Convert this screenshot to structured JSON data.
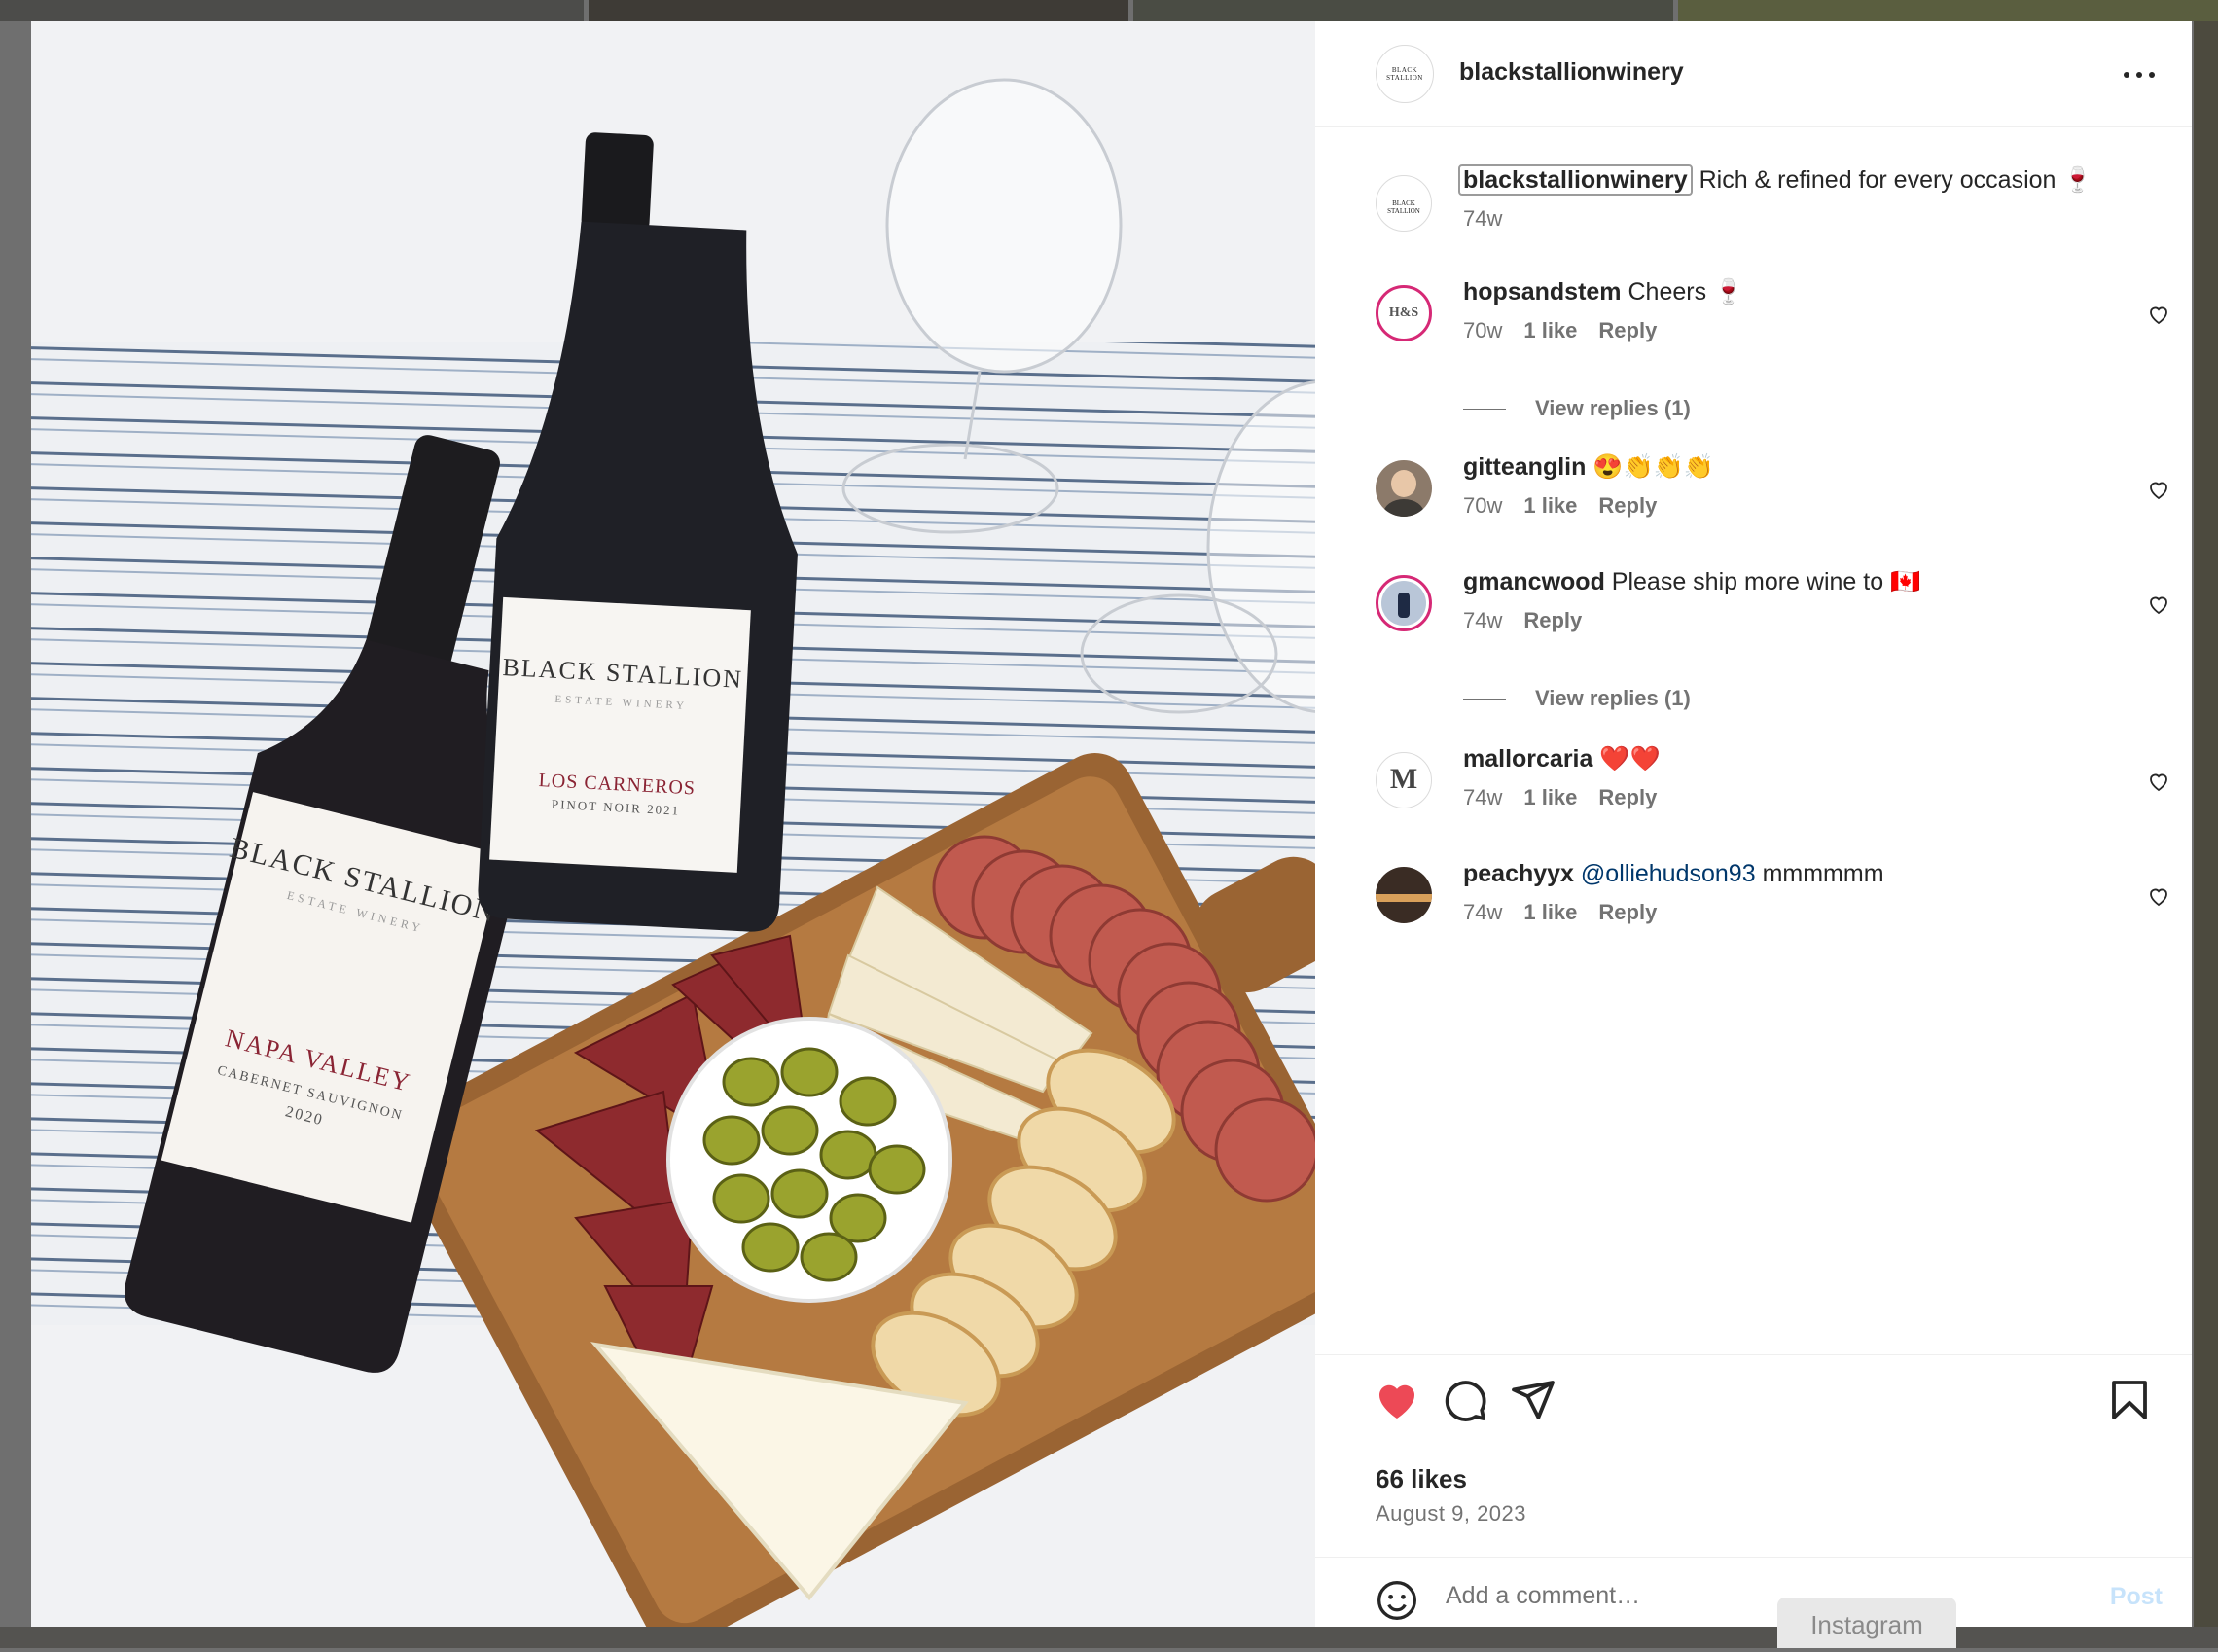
{
  "post": {
    "username": "blackstallionwinery",
    "avatar_logo_text": "BLACK STALLION",
    "caption": {
      "username": "blackstallionwinery",
      "text": "Rich & refined for every occasion 🍷",
      "age": "74w"
    },
    "photo": {
      "bottle_left": {
        "brand": "BLACK STALLION",
        "sub": "ESTATE WINERY",
        "region": "NAPA VALLEY",
        "varietal": "CABERNET SAUVIGNON",
        "year": "2020"
      },
      "bottle_right": {
        "brand": "BLACK STALLION",
        "sub": "ESTATE WINERY",
        "region": "LOS CARNEROS",
        "varietal": "PINOT NOIR 2021"
      }
    }
  },
  "comments": [
    {
      "username": "hopsandstem",
      "text": "Cheers 🍷",
      "age": "70w",
      "likes": "1 like",
      "reply": "Reply",
      "view_replies": "View replies (1)",
      "avatar_text": "H&S"
    },
    {
      "username": "gitteanglin",
      "text": "😍👏👏👏",
      "age": "70w",
      "likes": "1 like",
      "reply": "Reply"
    },
    {
      "username": "gmancwood",
      "text": "Please ship more wine to 🇨🇦",
      "age": "74w",
      "reply": "Reply",
      "view_replies": "View replies (1)"
    },
    {
      "username": "mallorcaria",
      "text": "❤️❤️",
      "age": "74w",
      "likes": "1 like",
      "reply": "Reply",
      "avatar_text": "M"
    },
    {
      "username": "peachyyx",
      "mention": "@olliehudson93",
      "text": "mmmmmm",
      "age": "74w",
      "likes": "1 like",
      "reply": "Reply"
    }
  ],
  "footer": {
    "likes": "66 likes",
    "date": "August 9, 2023",
    "comment_placeholder": "Add a comment…",
    "post_label": "Post"
  },
  "tooltip": "Instagram",
  "colors": {
    "like_red": "#ed4956",
    "mention_blue": "#00376b",
    "post_disabled": "#c7e3fb",
    "story_ring": "#d62976"
  }
}
